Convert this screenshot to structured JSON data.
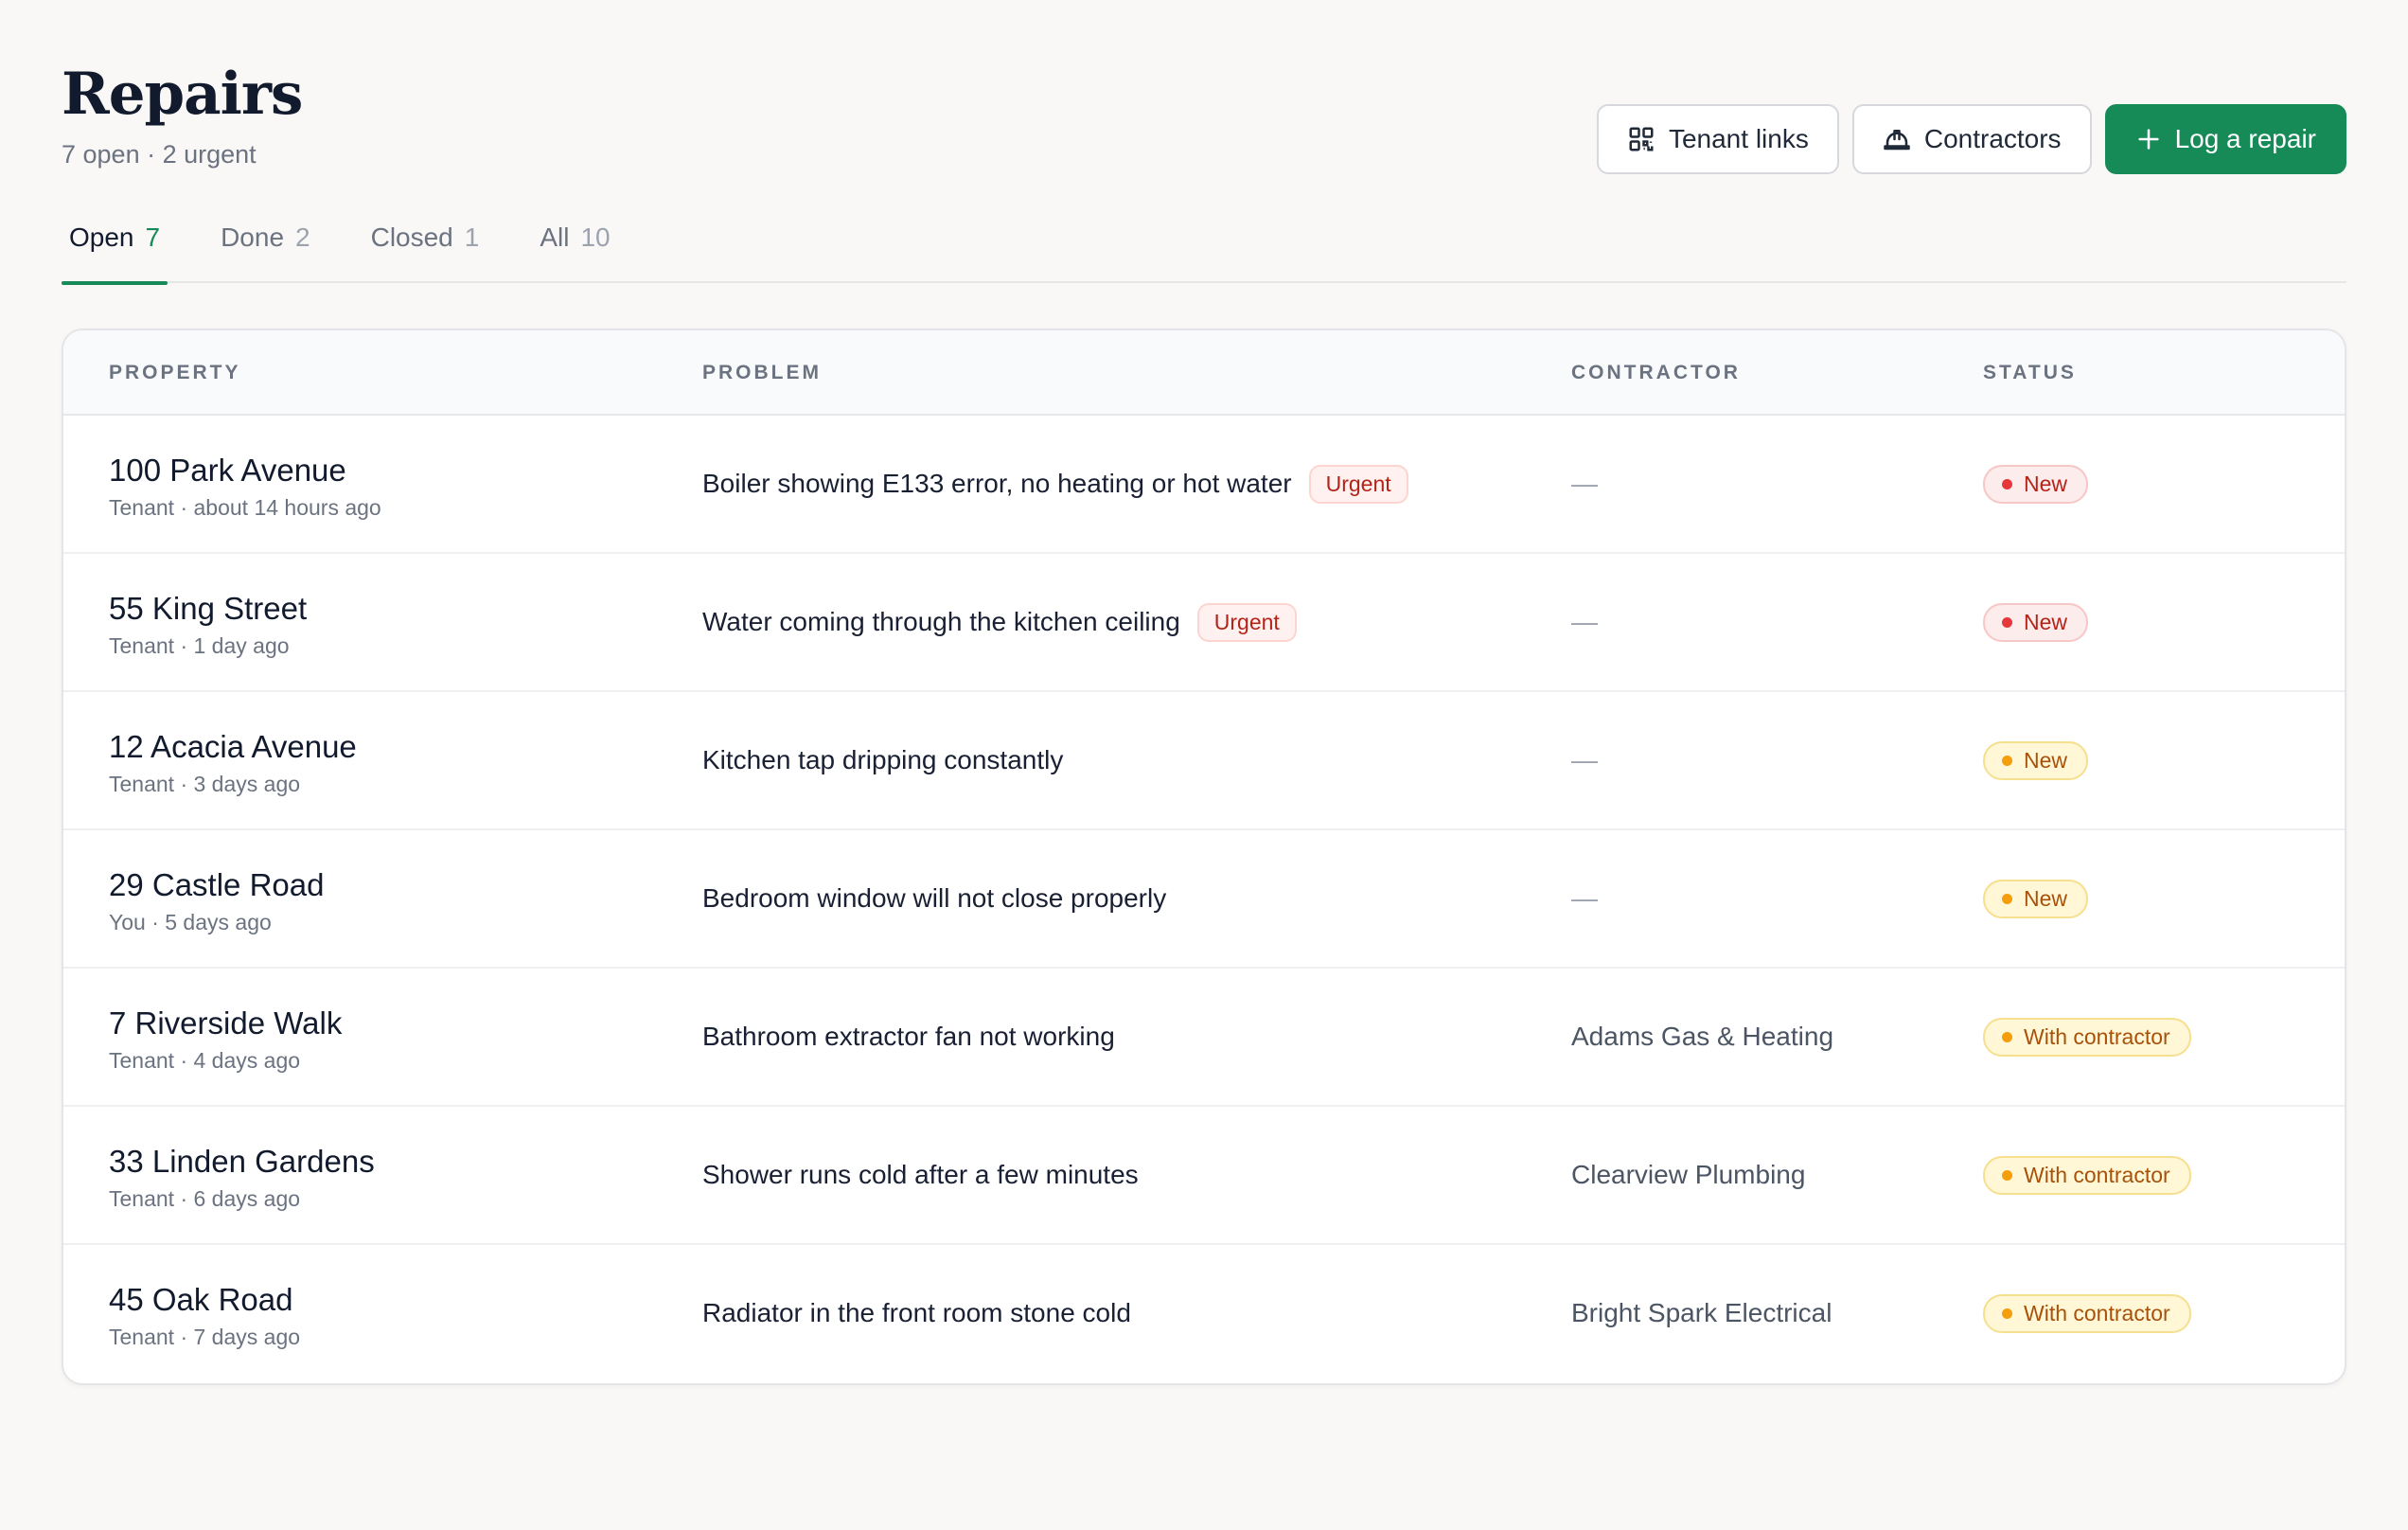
{
  "header": {
    "title": "Repairs",
    "subtitle": "7 open · 2 urgent",
    "buttons": {
      "tenant_links": "Tenant links",
      "contractors": "Contractors",
      "log_repair": "Log a repair"
    }
  },
  "tabs": [
    {
      "label": "Open",
      "count": "7"
    },
    {
      "label": "Done",
      "count": "2"
    },
    {
      "label": "Closed",
      "count": "1"
    },
    {
      "label": "All",
      "count": "10"
    }
  ],
  "table": {
    "headers": {
      "property": "PROPERTY",
      "problem": "PROBLEM",
      "contractor": "CONTRACTOR",
      "status": "STATUS"
    },
    "rows": [
      {
        "property": "100 Park Avenue",
        "meta": "Tenant · about 14 hours ago",
        "problem": "Boiler showing E133 error, no heating or hot water",
        "urgent": "Urgent",
        "contractor": "—",
        "status": "New",
        "status_color": "#e5383b"
      },
      {
        "property": "55 King Street",
        "meta": "Tenant · 1 day ago",
        "problem": "Water coming through the kitchen ceiling",
        "urgent": "Urgent",
        "contractor": "—",
        "status": "New",
        "status_color": "#e5383b"
      },
      {
        "property": "12 Acacia Avenue",
        "meta": "Tenant · 3 days ago",
        "problem": "Kitchen tap dripping constantly",
        "urgent": "",
        "contractor": "—",
        "status": "New",
        "status_color": "#f59e0b"
      },
      {
        "property": "29 Castle Road",
        "meta": "You · 5 days ago",
        "problem": "Bedroom window will not close properly",
        "urgent": "",
        "contractor": "—",
        "status": "New",
        "status_color": "#f59e0b"
      },
      {
        "property": "7 Riverside Walk",
        "meta": "Tenant · 4 days ago",
        "problem": "Bathroom extractor fan not working",
        "urgent": "",
        "contractor": "Adams Gas & Heating",
        "status": "With contractor",
        "status_color": "#f59e0b"
      },
      {
        "property": "33 Linden Gardens",
        "meta": "Tenant · 6 days ago",
        "problem": "Shower runs cold after a few minutes",
        "urgent": "",
        "contractor": "Clearview Plumbing",
        "status": "With contractor",
        "status_color": "#f59e0b"
      },
      {
        "property": "45 Oak Road",
        "meta": "Tenant · 7 days ago",
        "problem": "Radiator in the front room stone cold",
        "urgent": "",
        "contractor": "Bright Spark Electrical",
        "status": "With contractor",
        "status_color": "#f59e0b"
      }
    ]
  },
  "colors": {
    "accent": "#168a57",
    "urgent_red": "#e5383b",
    "warning_amber": "#f59e0b"
  },
  "icons": {
    "tenant_links": "qr-code-icon",
    "contractors": "hard-hat-icon",
    "log_repair": "plus-icon"
  }
}
